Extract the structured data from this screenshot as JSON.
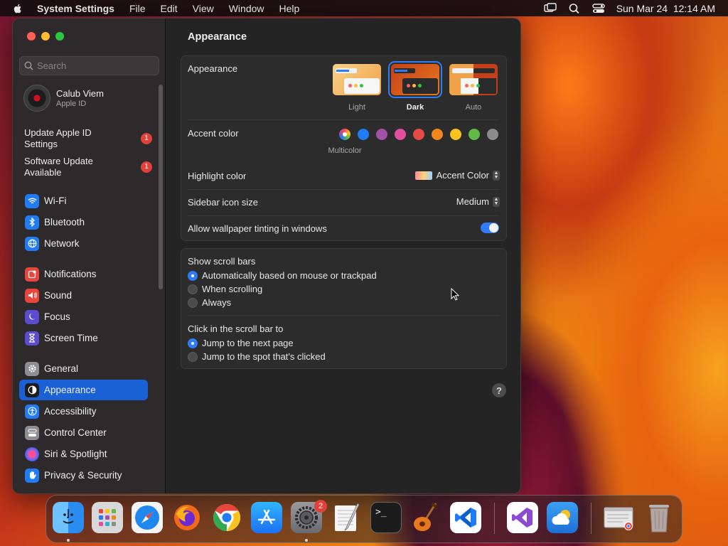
{
  "menubar": {
    "app_name": "System Settings",
    "items": [
      "File",
      "Edit",
      "View",
      "Window",
      "Help"
    ],
    "datetime": "Sun Mar 24  12:14 AM"
  },
  "sidebar": {
    "search_placeholder": "Search",
    "user": {
      "name": "Calub Viem",
      "subtitle": "Apple ID"
    },
    "alerts": [
      {
        "label": "Update Apple ID Settings",
        "badge": "1"
      },
      {
        "label": "Software Update Available",
        "badge": "1"
      }
    ],
    "items": [
      {
        "label": "Wi-Fi",
        "icon": "wifi-icon",
        "color": "#1f7cf5"
      },
      {
        "label": "Bluetooth",
        "icon": "bluetooth-icon",
        "color": "#1f7cf5"
      },
      {
        "label": "Network",
        "icon": "globe-icon",
        "color": "#1f7cf5"
      },
      {
        "label": "Notifications",
        "icon": "bell-icon",
        "color": "#e8453c"
      },
      {
        "label": "Sound",
        "icon": "speaker-icon",
        "color": "#e8453c"
      },
      {
        "label": "Focus",
        "icon": "moon-icon",
        "color": "#5b4ccf"
      },
      {
        "label": "Screen Time",
        "icon": "hourglass-icon",
        "color": "#5b4ccf"
      },
      {
        "label": "General",
        "icon": "gear-icon",
        "color": "#8e8e93"
      },
      {
        "label": "Appearance",
        "icon": "appearance-icon",
        "color": "#1c1c1e",
        "selected": true
      },
      {
        "label": "Accessibility",
        "icon": "accessibility-icon",
        "color": "#1f7cf5"
      },
      {
        "label": "Control Center",
        "icon": "control-center-icon",
        "color": "#8e8e93"
      },
      {
        "label": "Siri & Spotlight",
        "icon": "siri-icon",
        "color": "#b23fd6"
      },
      {
        "label": "Privacy & Security",
        "icon": "hand-icon",
        "color": "#1f7cf5"
      }
    ]
  },
  "main": {
    "title": "Appearance",
    "appearance": {
      "label": "Appearance",
      "options": [
        {
          "label": "Light",
          "selected": false
        },
        {
          "label": "Dark",
          "selected": true
        },
        {
          "label": "Auto",
          "selected": false
        }
      ]
    },
    "accent": {
      "label": "Accent color",
      "selected_label": "Multicolor",
      "colors": [
        "multicolor",
        "#1f7cf5",
        "#a550a7",
        "#e24f9d",
        "#e64a47",
        "#f2871e",
        "#f7c321",
        "#62ba46",
        "#8c8c8c"
      ]
    },
    "highlight": {
      "label": "Highlight color",
      "value": "Accent Color"
    },
    "sidebar_icon_size": {
      "label": "Sidebar icon size",
      "value": "Medium"
    },
    "wallpaper_tinting": {
      "label": "Allow wallpaper tinting in windows",
      "on": true
    },
    "scroll_bars": {
      "label": "Show scroll bars",
      "options": [
        {
          "label": "Automatically based on mouse or trackpad",
          "selected": true
        },
        {
          "label": "When scrolling",
          "selected": false
        },
        {
          "label": "Always",
          "selected": false
        }
      ]
    },
    "click_scroll": {
      "label": "Click in the scroll bar to",
      "options": [
        {
          "label": "Jump to the next page",
          "selected": true
        },
        {
          "label": "Jump to the spot that's clicked",
          "selected": false
        }
      ]
    },
    "help": "?"
  },
  "dock": {
    "apps": [
      {
        "name": "finder-icon",
        "color": "#2a8cf0",
        "running": true
      },
      {
        "name": "launchpad-icon",
        "color": "#d8d8d8",
        "running": false
      },
      {
        "name": "safari-icon",
        "color": "#1e88f0",
        "running": false
      },
      {
        "name": "firefox-icon",
        "color": "#f06a1a",
        "running": false
      },
      {
        "name": "chrome-icon",
        "color": "#ffffff",
        "running": false
      },
      {
        "name": "app-store-icon",
        "color": "#1d8cf5",
        "running": false
      },
      {
        "name": "system-settings-icon",
        "color": "#8e8e93",
        "running": true,
        "badge": "2"
      },
      {
        "name": "textedit-icon",
        "color": "#f5f5f5",
        "running": false
      },
      {
        "name": "terminal-icon",
        "color": "#1c1c1c",
        "running": false
      },
      {
        "name": "garageband-icon",
        "color": "#e8781e",
        "running": false
      },
      {
        "name": "vscode-icon",
        "color": "#ffffff",
        "running": false
      },
      {
        "name": "visual-studio-icon",
        "color": "#ffffff",
        "running": false
      },
      {
        "name": "weather-icon",
        "color": "#2f86e6",
        "running": false
      },
      {
        "name": "chrome-window-icon",
        "color": "#e6e6e6",
        "running": false
      },
      {
        "name": "trash-icon",
        "color": "#9a9a9a",
        "running": false
      }
    ]
  }
}
